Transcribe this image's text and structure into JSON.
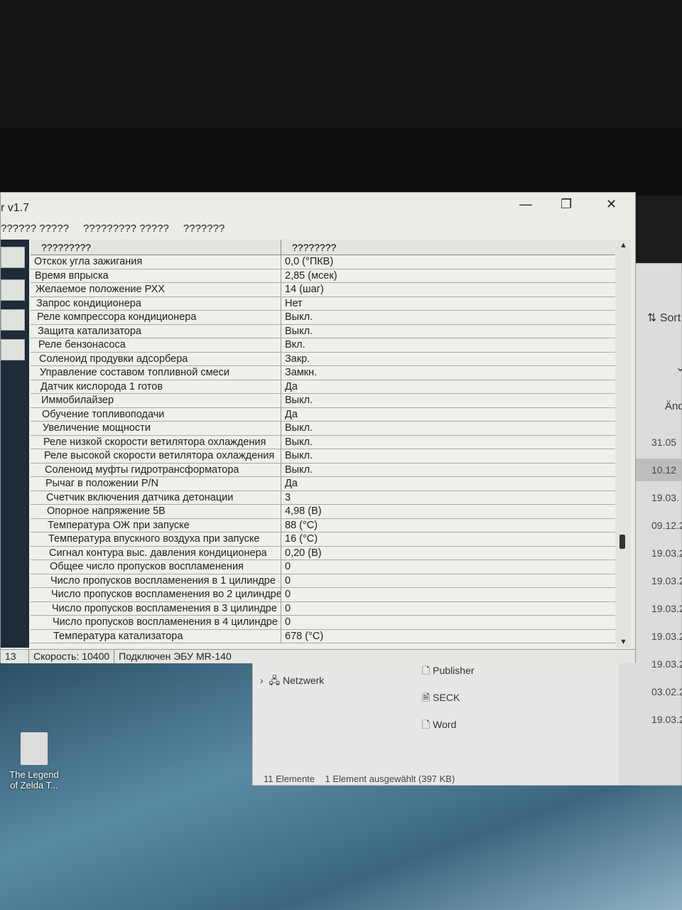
{
  "app": {
    "title": "r v1.7",
    "menu": [
      "?????? ?????",
      "????????? ?????",
      "???????"
    ],
    "grid": {
      "headers": [
        "?????????",
        "????????"
      ],
      "rows": [
        [
          "Отскок угла зажигания",
          "0,0  (°ПКВ)"
        ],
        [
          "Время впрыска",
          "2,85  (мсек)"
        ],
        [
          "Желаемое положение РХХ",
          "14  (шаг)"
        ],
        [
          "Запрос кондиционера",
          "Нет"
        ],
        [
          "Реле компрессора кондиционера",
          "Выкл."
        ],
        [
          "Защита катализатора",
          "Выкл."
        ],
        [
          "Реле бензонасоса",
          "Вкл."
        ],
        [
          "Соленоид продувки адсорбера",
          "Закр."
        ],
        [
          "Управление составом топливной смеси",
          "Замкн."
        ],
        [
          "Датчик кислорода 1 готов",
          "Да"
        ],
        [
          "Иммобилайзер",
          "Выкл."
        ],
        [
          "Обучение топливоподачи",
          "Да"
        ],
        [
          "Увеличение мощности",
          "Выкл."
        ],
        [
          "Реле низкой скорости ветилятора охлаждения",
          "Выкл."
        ],
        [
          "Реле высокой скорости ветилятора охлаждения",
          "Выкл."
        ],
        [
          "Соленоид муфты гидротрансформатора",
          "Выкл."
        ],
        [
          "Рычаг в положении P/N",
          "Да"
        ],
        [
          "Счетчик включения датчика детонации",
          "3"
        ],
        [
          "Опорное напряжение 5В",
          "4,98  (В)"
        ],
        [
          "Температура ОЖ при запуске",
          "88  (°C)"
        ],
        [
          "Температура впускного воздуха при запуске",
          "16  (°C)"
        ],
        [
          "Сигнал контура выс. давления кондиционера",
          "0,20  (В)"
        ],
        [
          "Общее число пропусков воспламенения",
          "0"
        ],
        [
          "Число пропусков воспламенения в 1 цилиндре",
          "0"
        ],
        [
          "Число пропусков воспламенения во 2 цилиндре",
          "0"
        ],
        [
          "Число пропусков воспламенения в 3 цилиндре",
          "0"
        ],
        [
          "Число пропусков воспламенения в 4 цилиндре",
          "0"
        ],
        [
          "Температура катализатора",
          "678  (°C)"
        ]
      ]
    },
    "status": [
      "13",
      "Скорость: 10400",
      "Подключен ЭБУ MR-140"
    ]
  },
  "explorer": {
    "sort": "Sort",
    "column": "Änd",
    "dates": [
      "31.05",
      "10.12",
      "19.03.",
      "09.12.2",
      "19.03.2",
      "19.03.20",
      "19.03.20",
      "19.03.20",
      "19.03.202",
      "03.02.202",
      "19.03.202"
    ],
    "nav": "Netzwerk",
    "files": [
      "Publisher",
      "SECK",
      "Word"
    ],
    "count": "11 Elemente",
    "selected": "1 Element ausgewählt (397 KB)"
  },
  "desktop": {
    "icon_label": "The Legend of Zelda T..."
  }
}
